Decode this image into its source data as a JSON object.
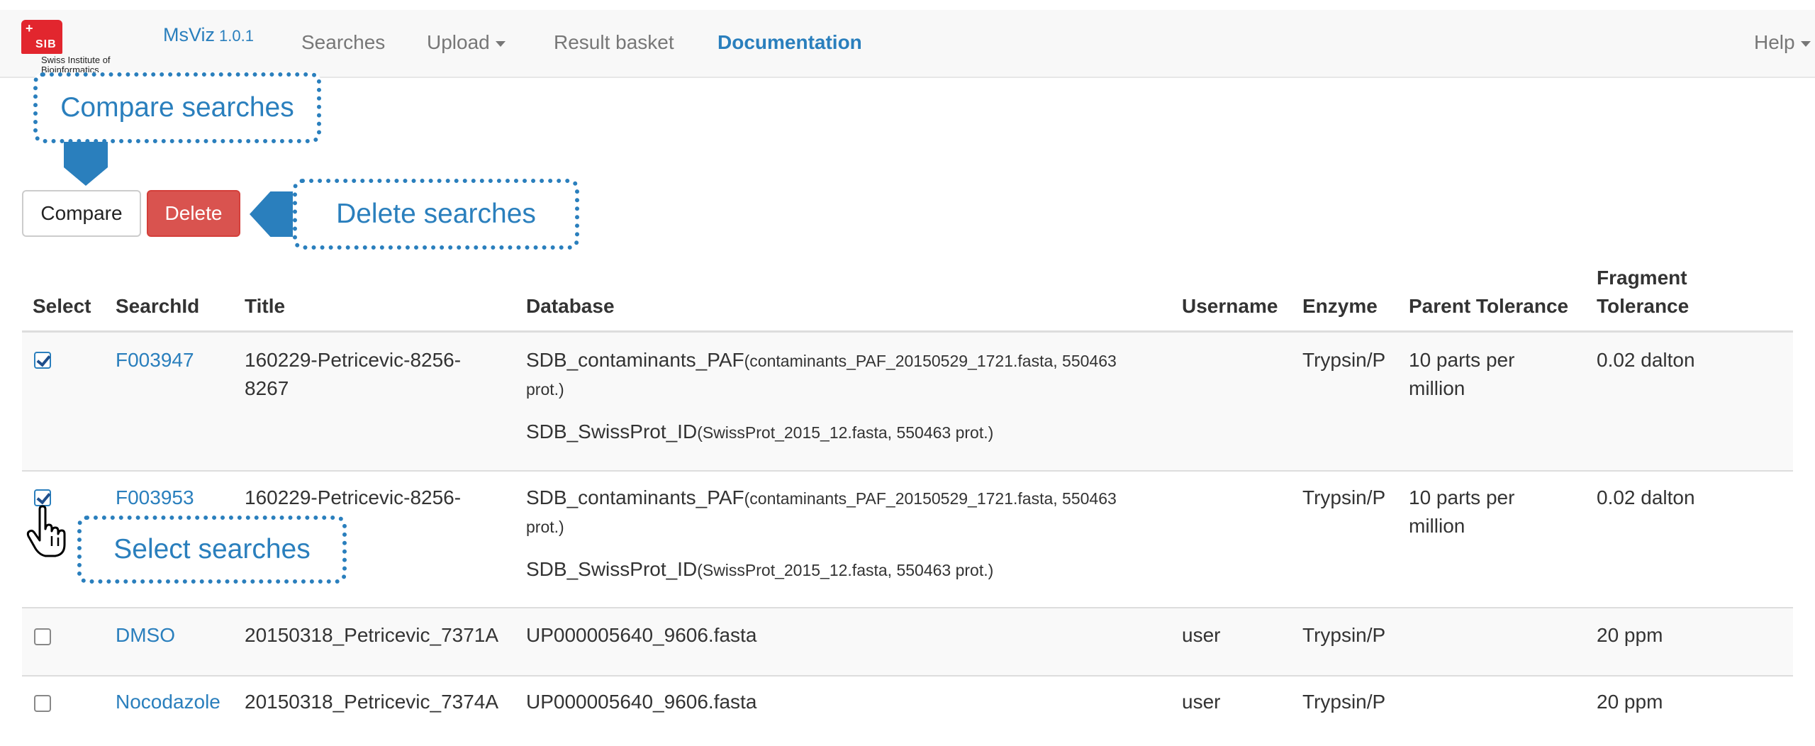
{
  "nav": {
    "logo_mark": "SIB",
    "logo_text_line1": "Swiss Institute of",
    "logo_text_line2": "Bioinformatics",
    "brand": "MsViz",
    "version": "1.0.1",
    "items": [
      "Searches",
      "Upload",
      "Result basket",
      "Documentation"
    ],
    "help": "Help"
  },
  "callouts": {
    "compare": "Compare searches",
    "delete": "Delete searches",
    "select": "Select searches"
  },
  "buttons": {
    "compare": "Compare",
    "delete": "Delete"
  },
  "colors": {
    "accent": "#2a7fbd",
    "danger": "#d9534f"
  },
  "table": {
    "headers": {
      "select": "Select",
      "search_id": "SearchId",
      "title": "Title",
      "database": "Database",
      "username": "Username",
      "enzyme": "Enzyme",
      "parent_tolerance": "Parent Tolerance",
      "fragment_tolerance_1": "Fragment",
      "fragment_tolerance_2": "Tolerance"
    },
    "rows": [
      {
        "checked": true,
        "search_id": "F003947",
        "title_1": "160229-Petricevic-8256-",
        "title_2": "8267",
        "db1_name": "SDB_contaminants_PAF",
        "db1_note_1": "(contaminants_PAF_20150529_1721.fasta, 550463",
        "db1_note_2": "prot.)",
        "db2_name": "SDB_SwissProt_ID",
        "db2_note": "(SwissProt_2015_12.fasta, 550463 prot.)",
        "username": "",
        "enzyme": "Trypsin/P",
        "parent_1": "10 parts per",
        "parent_2": "million",
        "fragment": "0.02 dalton"
      },
      {
        "checked": true,
        "search_id": "F003953",
        "title_1": "160229-Petricevic-8256-",
        "db1_name": "SDB_contaminants_PAF",
        "db1_note_1": "(contaminants_PAF_20150529_1721.fasta, 550463",
        "db1_note_2": "prot.)",
        "db2_name": "SDB_SwissProt_ID",
        "db2_note": "(SwissProt_2015_12.fasta, 550463 prot.)",
        "username": "",
        "enzyme": "Trypsin/P",
        "parent_1": "10 parts per",
        "parent_2": "million",
        "fragment": "0.02 dalton"
      },
      {
        "checked": false,
        "search_id": "DMSO",
        "title_1": "20150318_Petricevic_7371A",
        "db1_name": "UP000005640_9606.fasta",
        "username": "user",
        "enzyme": "Trypsin/P",
        "fragment": "20 ppm"
      },
      {
        "checked": false,
        "search_id": "Nocodazole",
        "title_1": "20150318_Petricevic_7374A",
        "db1_name": "UP000005640_9606.fasta",
        "username": "user",
        "enzyme": "Trypsin/P",
        "fragment": "20 ppm"
      }
    ]
  }
}
